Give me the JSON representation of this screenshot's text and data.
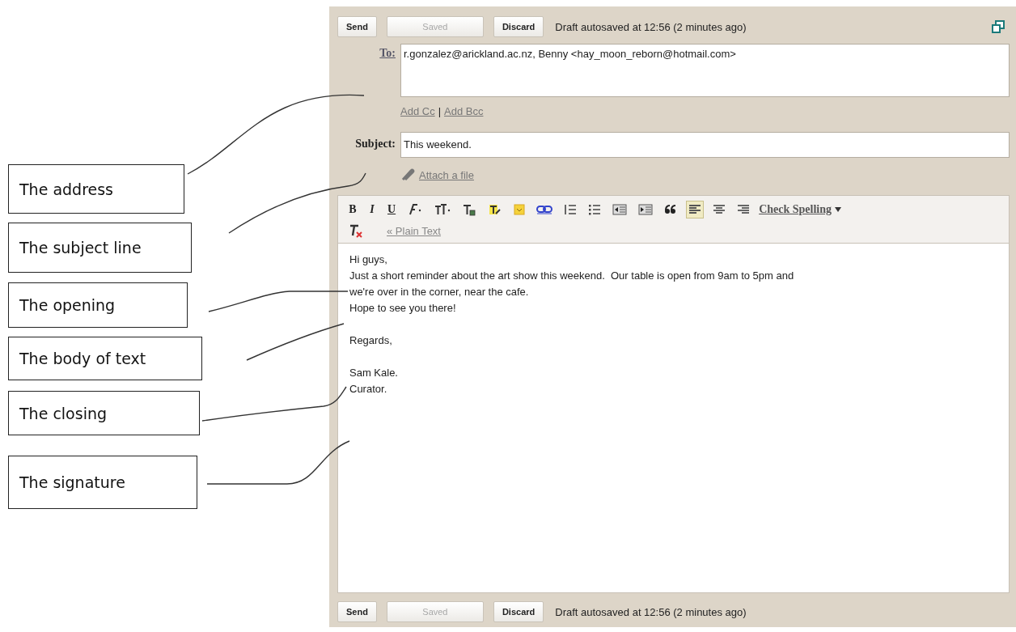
{
  "callouts": [
    {
      "label": "The address"
    },
    {
      "label": "The subject line"
    },
    {
      "label": "The opening"
    },
    {
      "label": "The body of text"
    },
    {
      "label": "The closing"
    },
    {
      "label": "The signature"
    }
  ],
  "top_bar": {
    "buttons": [
      {
        "label": "Send",
        "disabled": false
      },
      {
        "label": "Saved",
        "disabled": true
      },
      {
        "label": "Discard",
        "disabled": false
      }
    ],
    "status": "Draft autosaved at 12:56 (2 minutes ago)"
  },
  "to": {
    "label": "To:",
    "value": "r.gonzalez@arickland.ac.nz, Benny <hay_moon_reborn@hotmail.com>"
  },
  "recipient_links": [
    "Add Cc",
    "Add Bcc"
  ],
  "recipient_separator": "|",
  "subject": {
    "label": "Subject:",
    "value": "This weekend."
  },
  "attach": "Attach a file",
  "toolbar": {
    "rows": [
      {
        "buttons": [
          {
            "kind": "bold",
            "label": "B",
            "selected": false
          },
          {
            "kind": "italic",
            "label": "I",
            "selected": false
          },
          {
            "kind": "underline",
            "label": "U",
            "selected": false
          },
          {
            "kind": "font",
            "selected": false
          },
          {
            "kind": "size",
            "selected": false
          },
          {
            "kind": "text-color",
            "selected": false
          },
          {
            "kind": "highlight",
            "selected": false
          },
          {
            "kind": "emoji",
            "selected": false
          },
          {
            "kind": "link",
            "selected": false
          },
          {
            "kind": "numbered-list",
            "selected": false
          },
          {
            "kind": "bulleted-list",
            "selected": false
          },
          {
            "kind": "indent-less",
            "selected": false
          },
          {
            "kind": "indent-more",
            "selected": false
          },
          {
            "kind": "quote",
            "selected": false
          },
          {
            "kind": "align-left",
            "selected": true
          },
          {
            "kind": "align-center",
            "selected": false
          },
          {
            "kind": "align-right",
            "selected": false
          }
        ],
        "link": {
          "kind": "menu",
          "label": "Check Spelling"
        }
      },
      {
        "buttons": [
          {
            "kind": "remove-format",
            "selected": false
          }
        ],
        "link": {
          "kind": "plain",
          "label": "« Plain Text"
        }
      }
    ]
  },
  "body": [
    [
      "Hi guys,",
      "Just a short reminder about the art show this weekend.  Our table is open from 9am to 5pm and",
      "we're over in the corner, near the cafe.",
      "Hope to see you there!"
    ],
    [
      "Regards,"
    ],
    [
      "Sam Kale.",
      "Curator."
    ]
  ],
  "bottom_bar": {
    "buttons": [
      {
        "label": "Send",
        "disabled": false
      },
      {
        "label": "Saved",
        "disabled": true
      },
      {
        "label": "Discard",
        "disabled": false
      }
    ],
    "status": "Draft autosaved at 12:56 (2 minutes ago)"
  }
}
